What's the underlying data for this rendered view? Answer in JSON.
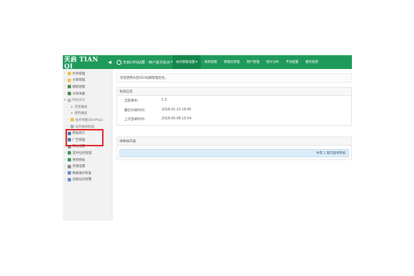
{
  "header": {
    "logo_text": "天启 TIAN QI",
    "site_label": "天启CMS站群 - 用户首次站点",
    "nav": [
      "站点基础设置",
      "采购管理",
      "管理员管理",
      "用户管理",
      "统计分析",
      "平台配置",
      "服务指南"
    ]
  },
  "sidebar": {
    "items": [
      {
        "label": "栏目管理",
        "type": "root",
        "icon_color": "#f0c24a"
      },
      {
        "label": "文章管理",
        "type": "root",
        "icon_color": "#f0c24a"
      },
      {
        "label": "模板管理",
        "type": "root",
        "icon_color": "#4a8f4a"
      },
      {
        "label": "文章采集",
        "type": "root",
        "icon_color": "#4a8f4a"
      },
      {
        "label": "网站优化",
        "type": "open",
        "icon_color": "#bbbbbb"
      },
      {
        "label": "百度推送",
        "type": "sub"
      },
      {
        "label": "搜狗推送",
        "type": "sub"
      },
      {
        "label": "站点地图(SiteMap)",
        "type": "sub2",
        "icon_color": "#f0c24a"
      },
      {
        "label": "站内链接管理",
        "type": "sub2",
        "icon_color": "#9fb6c9"
      },
      {
        "label": "网站统计",
        "type": "root",
        "icon_color": "#4a78b4"
      },
      {
        "label": "广告管理",
        "type": "root",
        "icon_color": "#4a78b4"
      },
      {
        "label": "网站设置",
        "type": "root",
        "icon_color": "#8c8c8c"
      },
      {
        "label": "定时任务管理",
        "type": "root",
        "icon_color": "#3a9b57"
      },
      {
        "label": "更新网站",
        "type": "root",
        "icon_color": "#3a9b57"
      },
      {
        "label": "存储设置",
        "type": "root",
        "icon_color": "#8c8c8c"
      },
      {
        "label": "数据备份恢复",
        "type": "root",
        "icon_color": "#6a8fc8"
      },
      {
        "label": "远程站点部署",
        "type": "root",
        "icon_color": "#6a8fc8"
      }
    ]
  },
  "main": {
    "welcome": "欢迎使用天启SEO站群管理后台。",
    "system_panel": {
      "title": "系统信息",
      "rows": [
        {
          "key": "当前版本：",
          "value": "5.0"
        },
        {
          "key": "最近升级时间：",
          "value": "2018-01-23 16:45"
        },
        {
          "key": "上次登录时间：",
          "value": "2018-05-08 15:54"
        }
      ]
    },
    "pending_panel": {
      "title": "待审核内容",
      "message": "共有 1 篇内容待审核"
    }
  },
  "colors": {
    "topbar": "#1f9a5a",
    "highlight_box": "#e01e1e"
  }
}
